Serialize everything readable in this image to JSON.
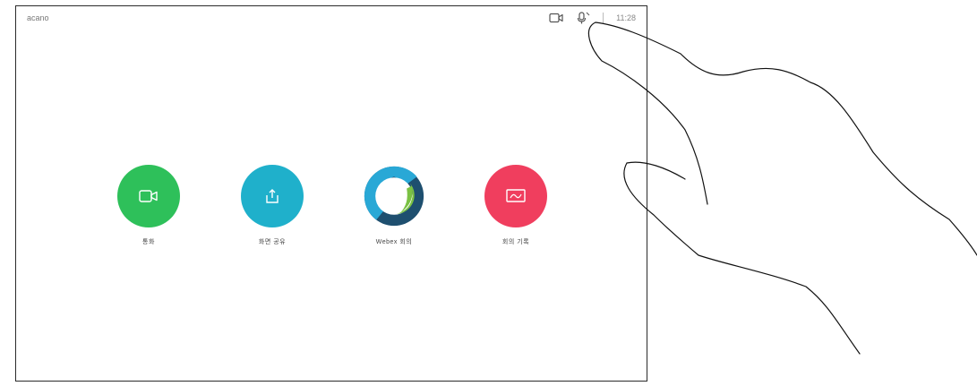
{
  "header": {
    "device_name": "acano",
    "time": "11:28",
    "camera_icon": "camera-icon",
    "mic_icon": "microphone-icon"
  },
  "tiles": [
    {
      "label": "통화",
      "color": "#2ec05a",
      "icon": "video-call-icon"
    },
    {
      "label": "화면 공유",
      "color": "#1fb0cb",
      "icon": "share-screen-icon"
    },
    {
      "label": "Webex 회의",
      "color": "#1e4f6f",
      "icon": "webex-icon"
    },
    {
      "label": "회의 기록",
      "color": "#f03e5e",
      "icon": "whiteboard-icon"
    }
  ]
}
